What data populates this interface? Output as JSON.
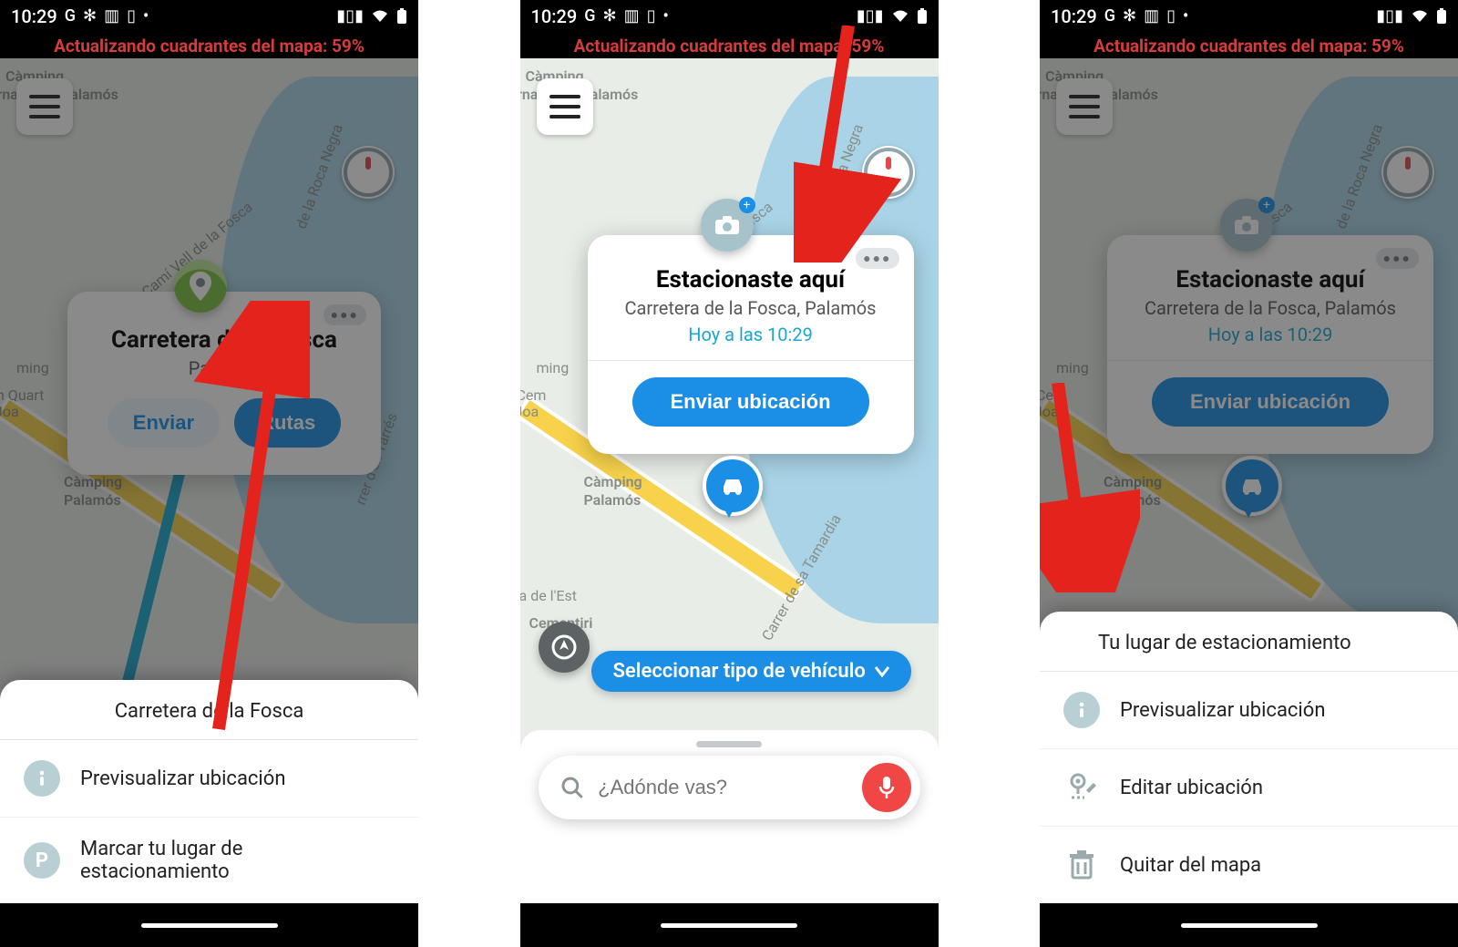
{
  "status": {
    "time": "10:29"
  },
  "banner": "Actualizando cuadrantes del mapa: 59%",
  "map_labels": {
    "camping": "Càmping",
    "intl": "ernacional Palamós",
    "cami": "Camí Vell de la Fosca",
    "roca": "de la Roca Negra",
    "tarres": "rrer d'en Tarrés",
    "quar": "n Quart",
    "ming": "ming",
    "joa": "Joa",
    "cem": "Cem",
    "camping2": "Càmping",
    "palamos2": "Palamós",
    "tamar": "Carrer de sa Tamardia",
    "lest": "da de l'Est",
    "cementiri": "Cementiri",
    "fosca": "Fosca"
  },
  "screen1": {
    "card_title": "Carretera de la Fosca",
    "card_sub": "Palamós",
    "btn_send": "Enviar",
    "btn_routes": "Rutas",
    "sheet_title": "Carretera de la Fosca",
    "item_preview": "Previsualizar ubicación",
    "item_mark": "Marcar tu lugar de estacionamiento"
  },
  "screen2": {
    "card_title": "Estacionaste aquí",
    "card_addr": "Carretera de la Fosca, Palamós",
    "card_time": "Hoy a las 10:29",
    "btn_send_loc": "Enviar ubicación",
    "vehicle_chip": "Seleccionar tipo de vehículo",
    "search_placeholder": "¿Adónde vas?"
  },
  "screen3": {
    "card_title": "Estacionaste aquí",
    "card_addr": "Carretera de la Fosca, Palamós",
    "card_time": "Hoy a las 10:29",
    "btn_send_loc": "Enviar ubicación",
    "sheet_title": "Tu lugar de estacionamiento",
    "item_preview": "Previsualizar ubicación",
    "item_edit": "Editar ubicación",
    "item_remove": "Quitar del mapa"
  }
}
